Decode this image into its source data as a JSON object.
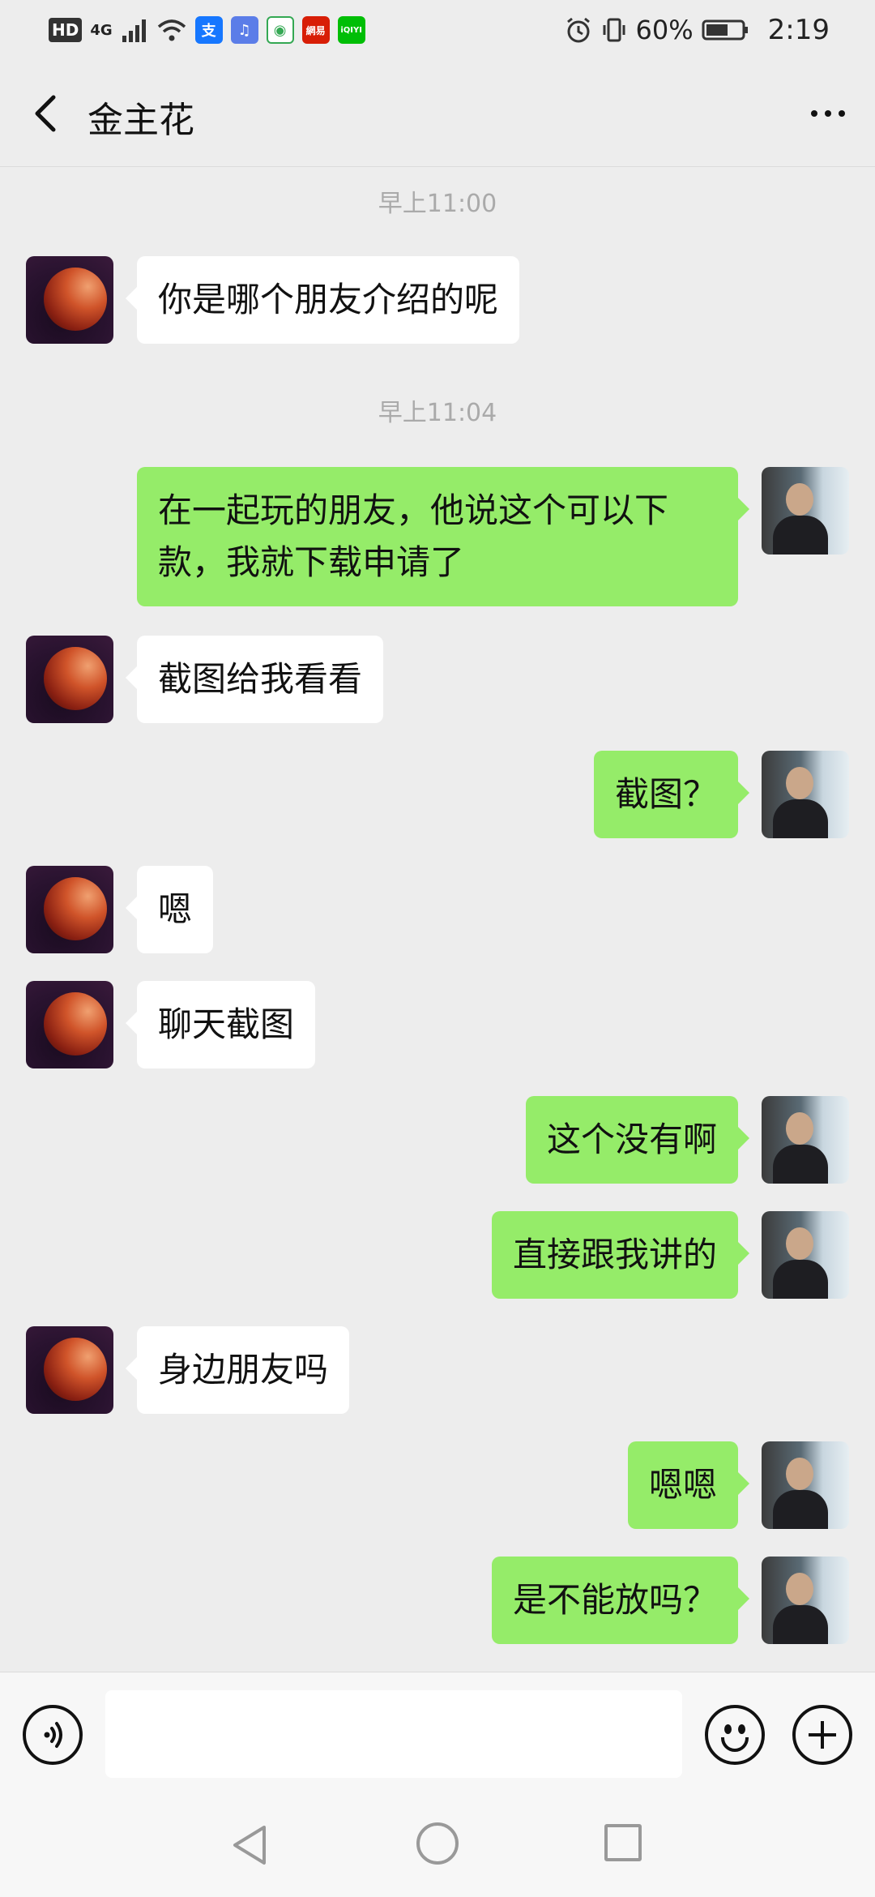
{
  "status_bar": {
    "hd": "HD",
    "signal": "4G",
    "battery": "60%",
    "time": "2:19",
    "app_icons": [
      {
        "name": "alipay-icon",
        "glyph": "支",
        "color": "#1677ff"
      },
      {
        "name": "music-icon",
        "glyph": "♫",
        "color": "#5b7de8"
      },
      {
        "name": "chrome-icon",
        "glyph": "◉",
        "color": "#34a853"
      },
      {
        "name": "netease-icon",
        "glyph": "網易",
        "color": "#d81e06"
      },
      {
        "name": "iqiyi-icon",
        "glyph": "iQIYI",
        "color": "#00be06"
      }
    ]
  },
  "nav": {
    "title": "金主花"
  },
  "chat": {
    "timestamps": [
      "早上11:00",
      "早上11:04"
    ],
    "messages": [
      {
        "side": "in",
        "text": "你是哪个朋友介绍的呢"
      },
      {
        "side": "out",
        "text": "在一起玩的朋友，他说这个可以下款，我就下载申请了"
      },
      {
        "side": "in",
        "text": "截图给我看看"
      },
      {
        "side": "out",
        "text": "截图？"
      },
      {
        "side": "in",
        "text": "嗯"
      },
      {
        "side": "in",
        "text": "聊天截图"
      },
      {
        "side": "out",
        "text": "这个没有啊"
      },
      {
        "side": "out",
        "text": "直接跟我讲的"
      },
      {
        "side": "in",
        "text": "身边朋友吗"
      },
      {
        "side": "out",
        "text": "嗯嗯"
      },
      {
        "side": "out",
        "text": "是不能放吗？"
      }
    ]
  },
  "input": {
    "value": "",
    "placeholder": ""
  }
}
